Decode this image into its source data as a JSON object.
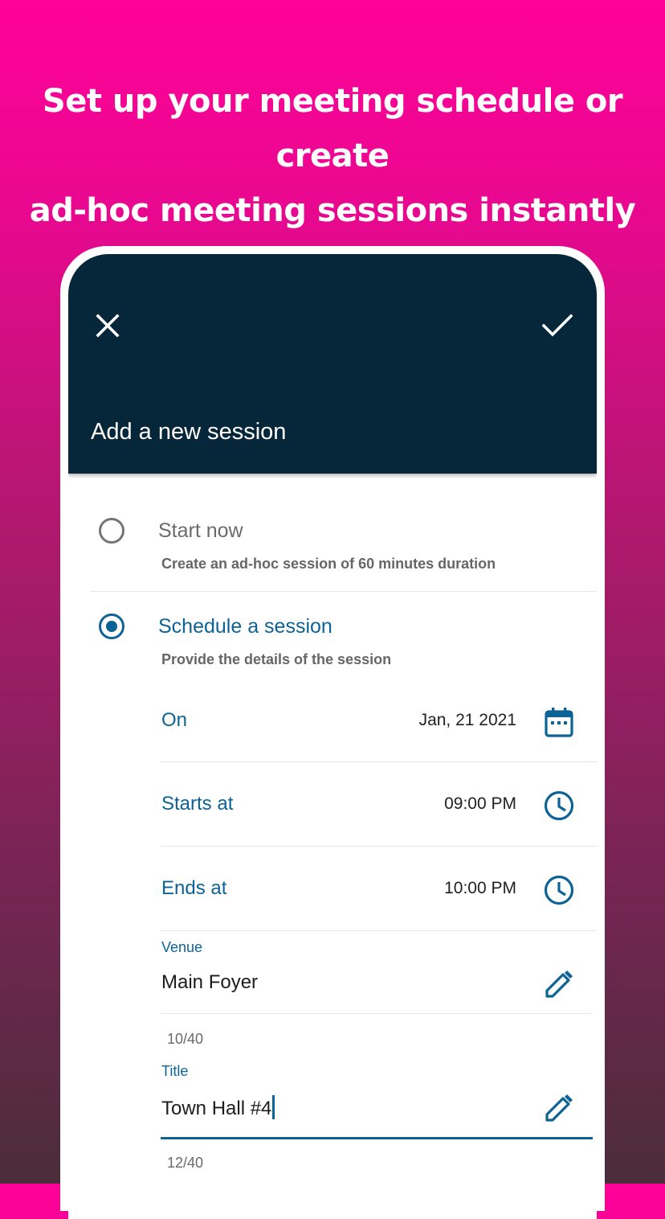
{
  "headline": {
    "line1": "Set up your meeting schedule or create",
    "line2": "ad-hoc meeting sessions instantly"
  },
  "appbar": {
    "close_icon": "close-icon",
    "confirm_icon": "check-icon",
    "title": "Add a new session",
    "background": "#06273a"
  },
  "options": {
    "start_now": {
      "label": "Start now",
      "description": "Create an ad-hoc session of 60 minutes duration",
      "selected": false
    },
    "schedule": {
      "label": "Schedule a session",
      "description": "Provide the details of the session",
      "selected": true
    }
  },
  "schedule": {
    "on": {
      "label": "On",
      "value": "Jan, 21 2021",
      "icon": "calendar-icon"
    },
    "starts_at": {
      "label": "Starts at",
      "value": "09:00 PM",
      "icon": "clock-icon"
    },
    "ends_at": {
      "label": "Ends at",
      "value": "10:00 PM",
      "icon": "clock-icon"
    },
    "venue": {
      "label": "Venue",
      "value": "Main Foyer",
      "counter": "10/40",
      "icon": "pencil-icon"
    },
    "title": {
      "label": "Title",
      "value": "Town Hall #4",
      "counter": "12/40",
      "icon": "pencil-icon"
    }
  },
  "colors": {
    "accent": "#0d6396",
    "gradient_top": "#ff0299",
    "gradient_bottom": "#4b2d3a"
  }
}
